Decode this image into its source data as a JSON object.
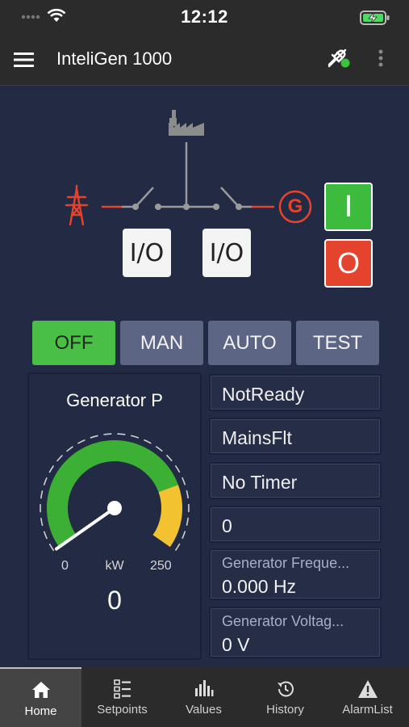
{
  "status_bar": {
    "time": "12:12"
  },
  "app_bar": {
    "title": "InteliGen 1000"
  },
  "scheme": {
    "breaker_mains_label": "I/O",
    "breaker_gen_label": "I/O",
    "start_label": "I",
    "stop_label": "O",
    "generator_symbol": "G",
    "colors": {
      "mains": "#e4442e",
      "line": "#9a9a9a",
      "start": "#3cbb3c",
      "stop": "#e4442e"
    }
  },
  "modes": [
    {
      "label": "OFF",
      "active": true
    },
    {
      "label": "MAN",
      "active": false
    },
    {
      "label": "AUTO",
      "active": false
    },
    {
      "label": "TEST",
      "active": false
    }
  ],
  "gauge": {
    "title": "Generator P",
    "min": "0",
    "unit": "kW",
    "max": "250",
    "value": "0",
    "level": 0,
    "colors": {
      "normal": "#3cb034",
      "warning": "#f2c230"
    }
  },
  "status_boxes": [
    {
      "text": "NotReady"
    },
    {
      "text": "MainsFlt"
    },
    {
      "text": "No Timer"
    },
    {
      "text": "0"
    }
  ],
  "values": [
    {
      "label": "Generator Freque...",
      "value": "0.000  Hz"
    },
    {
      "label": "Generator Voltag...",
      "value": "0  V"
    }
  ],
  "tabs": [
    {
      "label": "Home",
      "icon": "home-icon",
      "active": true
    },
    {
      "label": "Setpoints",
      "icon": "setpoints-list-icon",
      "active": false
    },
    {
      "label": "Values",
      "icon": "bar-chart-icon",
      "active": false
    },
    {
      "label": "History",
      "icon": "history-icon",
      "active": false
    },
    {
      "label": "AlarmList",
      "icon": "alarm-warning-icon",
      "active": false
    }
  ]
}
